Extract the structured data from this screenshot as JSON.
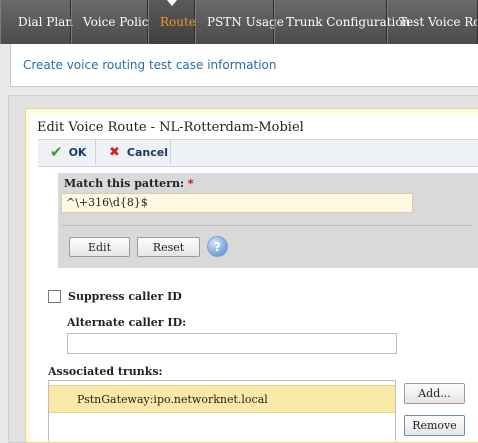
{
  "nav": {
    "items": [
      "Dial Plan",
      "Voice Policy",
      "Route",
      "PSTN Usage",
      "Trunk Configuration",
      "Test Voice Routing"
    ],
    "active": "Route"
  },
  "infobar": {
    "link": "Create voice routing test case information"
  },
  "dialog": {
    "title": "Edit Voice Route - NL-Rotterdam-Mobiel",
    "ok_label": "OK",
    "cancel_label": "Cancel"
  },
  "pattern": {
    "label": "Match this pattern:",
    "required_mark": "*",
    "value": "^\\+316\\d{8}$",
    "edit_label": "Edit",
    "reset_label": "Reset",
    "help_glyph": "?"
  },
  "caller_id": {
    "suppress_label": "Suppress caller ID",
    "suppress_checked": false,
    "alternate_label": "Alternate caller ID:",
    "alternate_value": ""
  },
  "trunks": {
    "label": "Associated trunks:",
    "items": [
      "PstnGateway:ipo.networknet.local"
    ],
    "add_label": "Add...",
    "remove_label": "Remove"
  },
  "icons": {
    "ok": "check-icon",
    "cancel": "x-icon",
    "help": "help-icon"
  },
  "colors": {
    "active_tab": "#f0962a",
    "link": "#2a6ea6",
    "selected_row": "#fbe9a9"
  }
}
